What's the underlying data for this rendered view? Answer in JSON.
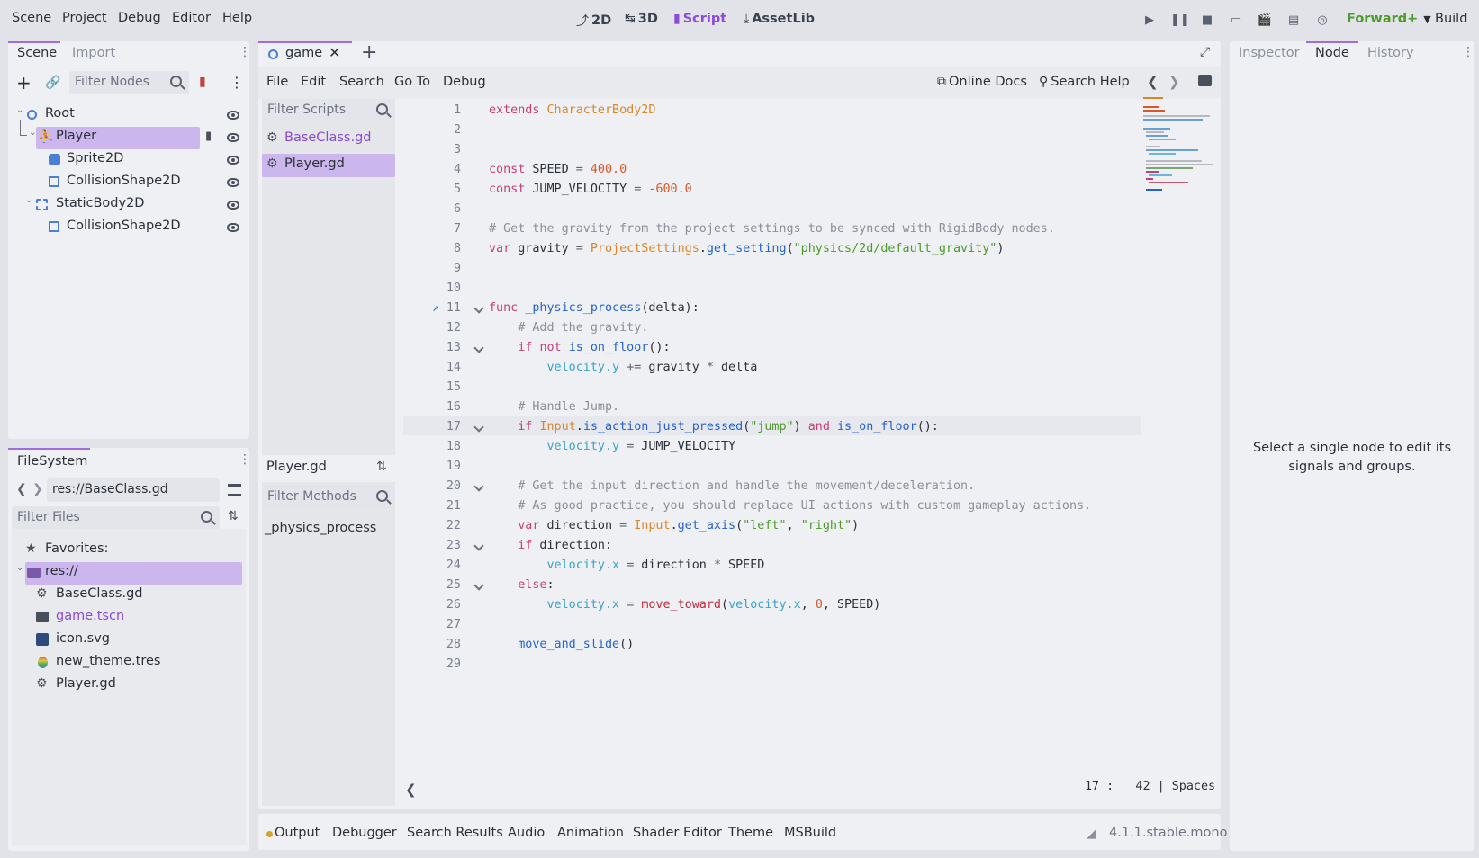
{
  "menu": [
    "Scene",
    "Project",
    "Debug",
    "Editor",
    "Help"
  ],
  "workspaces": [
    {
      "label": "2D",
      "icon": "2d-icon"
    },
    {
      "label": "3D",
      "icon": "3d-icon"
    },
    {
      "label": "Script",
      "icon": "script-icon"
    },
    {
      "label": "AssetLib",
      "icon": "assetlib-icon"
    }
  ],
  "renderer": "Forward+",
  "build_label": "Build",
  "scene_dock": {
    "tabs": [
      "Scene",
      "Import"
    ],
    "filter_placeholder": "Filter Nodes",
    "nodes": [
      "Root",
      "Player",
      "Sprite2D",
      "CollisionShape2D",
      "StaticBody2D",
      "CollisionShape2D"
    ]
  },
  "filesystem": {
    "tab": "FileSystem",
    "path": "res://BaseClass.gd",
    "filter_placeholder": "Filter Files",
    "favorites": "Favorites:",
    "root": "res://",
    "files": [
      "BaseClass.gd",
      "game.tscn",
      "icon.svg",
      "new_theme.tres",
      "Player.gd"
    ]
  },
  "scene_tab": "game",
  "script_menu": [
    "File",
    "Edit",
    "Search",
    "Go To",
    "Debug"
  ],
  "online_docs": "Online Docs",
  "search_help": "Search Help",
  "scripts": {
    "filter_placeholder": "Filter Scripts",
    "items": [
      "BaseClass.gd",
      "Player.gd"
    ],
    "current": "Player.gd",
    "methods_placeholder": "Filter Methods",
    "methods": [
      "_physics_process"
    ]
  },
  "code": {
    "line_numbers": [
      "1",
      "2",
      "3",
      "4",
      "5",
      "6",
      "7",
      "8",
      "9",
      "10",
      "11",
      "12",
      "13",
      "14",
      "15",
      "16",
      "17",
      "18",
      "19",
      "20",
      "21",
      "22",
      "23",
      "24",
      "25",
      "26",
      "27",
      "28",
      "29"
    ],
    "lines": [
      "extends CharacterBody2D",
      "",
      "",
      "const SPEED = 400.0",
      "const JUMP_VELOCITY = -600.0",
      "",
      "# Get the gravity from the project settings to be synced with RigidBody nodes.",
      "var gravity = ProjectSettings.get_setting(\"physics/2d/default_gravity\")",
      "",
      "",
      "func _physics_process(delta):",
      "    # Add the gravity.",
      "    if not is_on_floor():",
      "        velocity.y += gravity * delta",
      "",
      "    # Handle Jump.",
      "    if Input.is_action_just_pressed(\"jump\") and is_on_floor():",
      "        velocity.y = JUMP_VELOCITY",
      "",
      "    # Get the input direction and handle the movement/deceleration.",
      "    # As good practice, you should replace UI actions with custom gameplay actions.",
      "    var direction = Input.get_axis(\"left\", \"right\")",
      "    if direction:",
      "        velocity.x = direction * SPEED",
      "    else:",
      "        velocity.x = move_toward(velocity.x, 0, SPEED)",
      "",
      "    move_and_slide()",
      ""
    ],
    "status": "17 :   42 | Spaces"
  },
  "right_dock": {
    "tabs": [
      "Inspector",
      "Node",
      "History"
    ],
    "message": "Select a single node to edit its signals and groups."
  },
  "bottom_tabs": [
    "Output",
    "Debugger",
    "Search Results",
    "Audio",
    "Animation",
    "Shader Editor",
    "Theme",
    "MSBuild"
  ],
  "version": "4.1.1.stable.mono"
}
